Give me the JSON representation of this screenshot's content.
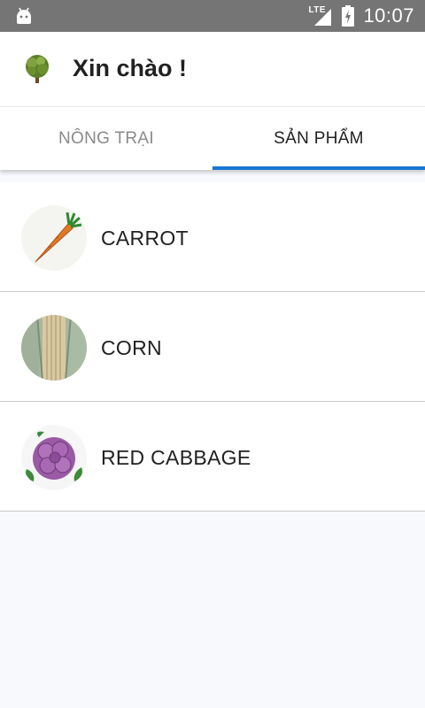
{
  "status_bar": {
    "network": "LTE",
    "time": "10:07"
  },
  "app_bar": {
    "title": "Xin chào !",
    "logo_icon": "tree-icon"
  },
  "tabs": [
    {
      "label": "NÔNG TRẠI",
      "active": false
    },
    {
      "label": "SẢN PHẨM",
      "active": true
    }
  ],
  "products": [
    {
      "name": "CARROT",
      "icon": "carrot-icon"
    },
    {
      "name": "CORN",
      "icon": "corn-icon"
    },
    {
      "name": "RED CABBAGE",
      "icon": "red-cabbage-icon"
    }
  ],
  "colors": {
    "accent": "#1976d2",
    "status_bar": "#757575",
    "background": "#f7f9fc"
  }
}
